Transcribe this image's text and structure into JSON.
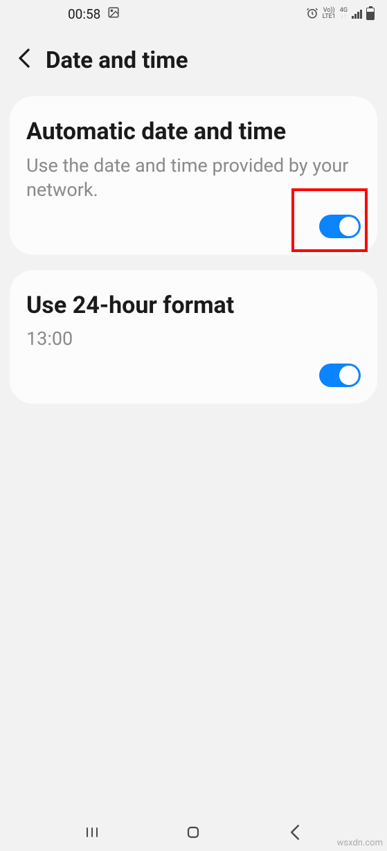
{
  "status_bar": {
    "time": "00:58",
    "volte_label": "Vo))",
    "lte_label": "LTE1",
    "network_label": "4G"
  },
  "header": {
    "title": "Date and time"
  },
  "settings": {
    "auto_date": {
      "title": "Automatic date and time",
      "subtitle": "Use the date and time provided by your network."
    },
    "hour_format": {
      "title": "Use 24-hour format",
      "subtitle": "13:00"
    }
  },
  "watermark": "wsxdn.com"
}
